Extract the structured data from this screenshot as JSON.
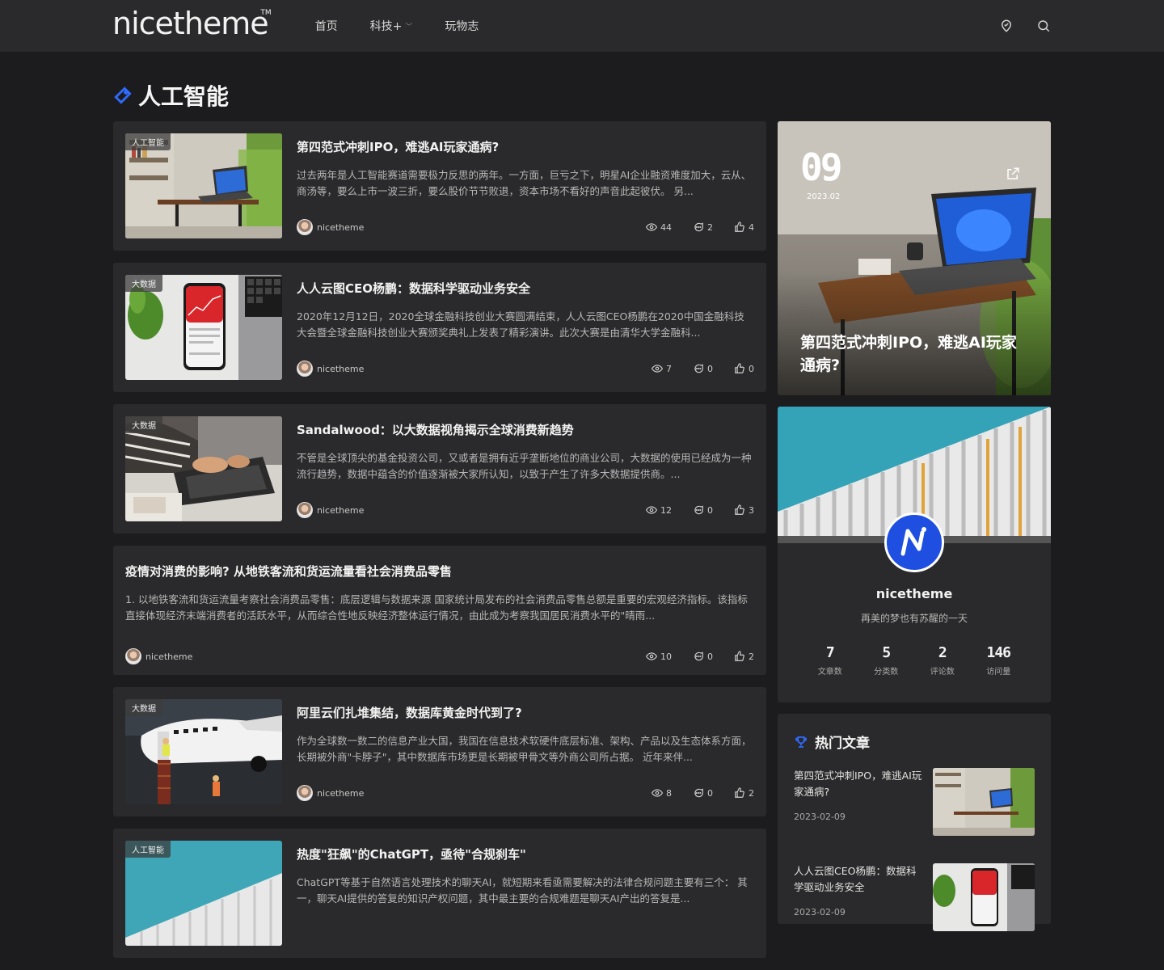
{
  "header": {
    "logo": "nicetheme",
    "logo_tm": "TM",
    "nav": [
      {
        "label": "首页"
      },
      {
        "label": "科技+"
      },
      {
        "label": "玩物志"
      }
    ]
  },
  "page": {
    "title": "人工智能"
  },
  "articles": [
    {
      "category": "人工智能",
      "title": "第四范式冲刺IPO，难逃AI玩家通病?",
      "excerpt": "过去两年是人工智能赛道需要极力反思的两年。一方面，巨亏之下，明星AI企业融资难度加大，云从、商汤等，要么上市一波三折，要么股价节节败退，资本市场不看好的声音此起彼伏。 另...",
      "author": "nicetheme",
      "views": "44",
      "comments": "2",
      "likes": "4"
    },
    {
      "category": "大数据",
      "title": "人人云图CEO杨鹏：数据科学驱动业务安全",
      "excerpt": "2020年12月12日，2020全球金融科技创业大赛圆满结束，人人云图CEO杨鹏在2020中国金融科技大会暨全球金融科技创业大赛颁奖典礼上发表了精彩演讲。此次大赛是由清华大学金融科...",
      "author": "nicetheme",
      "views": "7",
      "comments": "0",
      "likes": "0"
    },
    {
      "category": "大数据",
      "title": "Sandalwood：以大数据视角揭示全球消费新趋势",
      "excerpt": "不管是全球顶尖的基金投资公司，又或者是拥有近乎垄断地位的商业公司，大数据的使用已经成为一种流行趋势，数据中蕴含的价值逐渐被大家所认知，以致于产生了许多大数据提供商。...",
      "author": "nicetheme",
      "views": "12",
      "comments": "0",
      "likes": "3"
    },
    {
      "title": "疫情对消费的影响? 从地铁客流和货运流量看社会消费品零售",
      "excerpt": "1. 以地铁客流和货运流量考察社会消费品零售：底层逻辑与数据来源 国家统计局发布的社会消费品零售总额是重要的宏观经济指标。该指标直接体现经济末端消费者的活跃水平，从而综合性地反映经济整体运行情况，由此成为考察我国居民消费水平的\"晴雨...",
      "author": "nicetheme",
      "views": "10",
      "comments": "0",
      "likes": "2"
    },
    {
      "category": "大数据",
      "title": "阿里云们扎堆集结，数据库黄金时代到了?",
      "excerpt": "作为全球数一数二的信息产业大国，我国在信息技术软硬件底层标准、架构、产品以及生态体系方面，长期被外商\"卡脖子\"，其中数据库市场更是长期被甲骨文等外商公司所占据。 近年来伴...",
      "author": "nicetheme",
      "views": "8",
      "comments": "0",
      "likes": "2"
    },
    {
      "category": "人工智能",
      "title": "热度\"狂飙\"的ChatGPT，亟待\"合规刹车\"",
      "excerpt": "ChatGPT等基于自然语言处理技术的聊天AI，就短期来看亟需要解决的法律合规问题主要有三个： 其一，聊天AI提供的答复的知识产权问题，其中最主要的合规难题是聊天AI产出的答复是..."
    }
  ],
  "featured": {
    "day": "09",
    "month": "2023.02",
    "title": "第四范式冲刺IPO，难逃AI玩家通病?"
  },
  "profile": {
    "name": "nicetheme",
    "motto": "再美的梦也有苏醒的一天",
    "stats": [
      {
        "num": "7",
        "label": "文章数"
      },
      {
        "num": "5",
        "label": "分类数"
      },
      {
        "num": "2",
        "label": "评论数"
      },
      {
        "num": "146",
        "label": "访问量"
      }
    ]
  },
  "hot": {
    "heading": "热门文章",
    "items": [
      {
        "title": "第四范式冲刺IPO，难逃AI玩家通病?",
        "date": "2023-02-09"
      },
      {
        "title": "人人云图CEO杨鹏：数据科学驱动业务安全",
        "date": "2023-02-09"
      }
    ]
  },
  "colors": {
    "background": "#1c1c1e",
    "card": "#2a2a2c",
    "accent": "#2f6bff"
  }
}
